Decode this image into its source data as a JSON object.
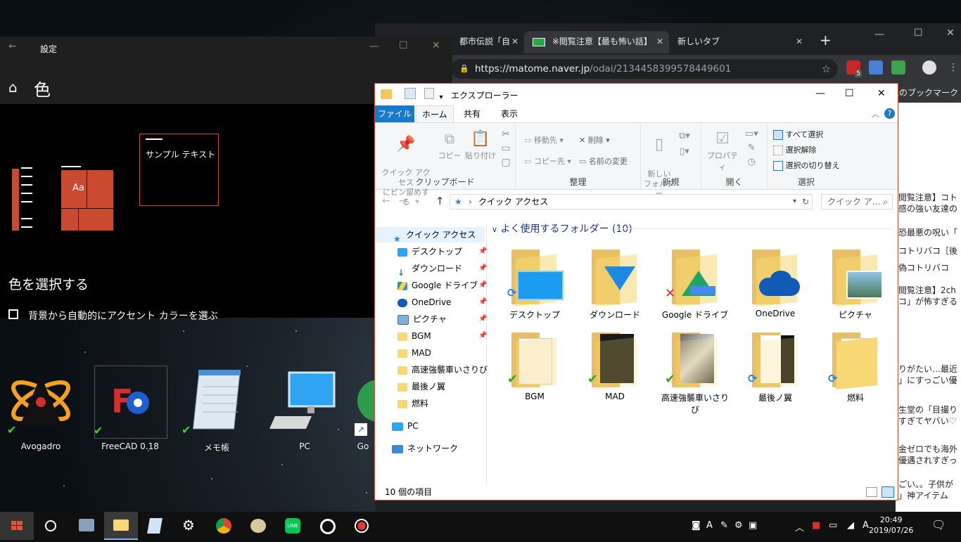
{
  "chrome": {
    "tabs": [
      {
        "label": "都市伝説「自",
        "close": "✕"
      },
      {
        "label": "※閲覧注意【最も怖い話】",
        "close": "✕"
      },
      {
        "label": "新しいタブ",
        "close": "✕"
      }
    ],
    "new_tab": "+",
    "url_host": "https://matome.naver.jp",
    "url_path": "/odai/2134458399578449601",
    "bookmarks_other": "の他のブックマーク",
    "adblock_count": "5",
    "page_lines": [
      "閲覧注意】コト",
      "感の強い友達の",
      "恐最悪の呪い「",
      "コトリバコ［後",
      "偽コトリバコ",
      "閲覧注意】2ch",
      "コ」が怖すぎる",
      "りがたい…最近",
      "」にすっごい優",
      "生堂の「目撮り",
      "すぎてヤバい♡",
      "金ゼロでも海外",
      "優遇されすぎっ",
      "ごい。。子供が",
      "」神アイテム"
    ]
  },
  "settings": {
    "title": "設定",
    "back": "←",
    "heading": "色",
    "sample_text": "サンプル テキスト",
    "choose_color": "色を選択する",
    "auto_accent": "背景から自動的にアクセント カラーを選ぶ",
    "tile_label": "Aa"
  },
  "desktop": {
    "icons": [
      {
        "label": "Avogadro"
      },
      {
        "label": "FreeCAD 0.18"
      },
      {
        "label": "メモ帳"
      },
      {
        "label": "PC"
      },
      {
        "label": "Go"
      }
    ]
  },
  "explorer": {
    "title": "エクスプローラー",
    "ribbon_tabs": [
      "ファイル",
      "ホーム",
      "共有",
      "表示"
    ],
    "clipboard": {
      "pin": "クイック アクセス\nにピン留めする",
      "copy": "コピー",
      "paste": "貼り付け",
      "group": "クリップボード"
    },
    "organize": {
      "move": "移動先 ▾",
      "copyto": "コピー先 ▾",
      "delete": "削除 ▾",
      "rename": "名前の変更",
      "group": "整理"
    },
    "new": {
      "folder": "新しい\nフォルダー",
      "group": "新規"
    },
    "open": {
      "props": "プロパティ",
      "group": "開く"
    },
    "select": {
      "all": "すべて選択",
      "none": "選択解除",
      "invert": "選択の切り替え",
      "group": "選択"
    },
    "breadcrumb": "クイック アクセス",
    "search_placeholder": "クイック ア...",
    "group_header": "よく使用するフォルダー (10)",
    "sidebar": [
      {
        "label": "クイック アクセス",
        "pinned": false
      },
      {
        "label": "デスクトップ",
        "pinned": true
      },
      {
        "label": "ダウンロード",
        "pinned": true
      },
      {
        "label": "Google ドライブ",
        "pinned": true
      },
      {
        "label": "OneDrive",
        "pinned": true
      },
      {
        "label": "ピクチャ",
        "pinned": true
      },
      {
        "label": "BGM",
        "pinned": true
      },
      {
        "label": "MAD",
        "pinned": false
      },
      {
        "label": "高速強襲車いさりび",
        "pinned": false
      },
      {
        "label": "最後ノ翼",
        "pinned": false
      },
      {
        "label": "燃料",
        "pinned": false
      },
      {
        "label": "PC",
        "pinned": false
      },
      {
        "label": "ネットワーク",
        "pinned": false
      }
    ],
    "folders": [
      {
        "label": "デスクトップ",
        "status": "sync"
      },
      {
        "label": "ダウンロード",
        "status": "none"
      },
      {
        "label": "Google ドライブ",
        "status": "error"
      },
      {
        "label": "OneDrive",
        "status": "none"
      },
      {
        "label": "ピクチャ",
        "status": "none"
      },
      {
        "label": "BGM",
        "status": "check"
      },
      {
        "label": "MAD",
        "status": "check"
      },
      {
        "label": "高速強襲車いさり\nび",
        "status": "check"
      },
      {
        "label": "最後ノ翼",
        "status": "sync"
      },
      {
        "label": "燃料",
        "status": "sync"
      }
    ],
    "status_text": "10 個の項目"
  },
  "taskbar": {
    "time": "20:49",
    "date": "2019/07/26",
    "ime": "A"
  },
  "colors": {
    "accent": "#c94a2e",
    "explorer_blue": "#1979ca",
    "folder_yellow": "#f8d775"
  }
}
